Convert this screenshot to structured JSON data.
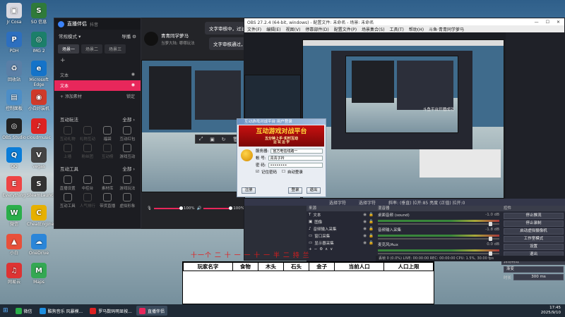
{
  "desktop_icons": [
    {
      "label": "Jr Cosa",
      "color": "#d8d8e0",
      "glyph": "▣"
    },
    {
      "label": "SO 信息",
      "color": "#2f7a3a",
      "glyph": "S"
    },
    {
      "label": "PDH",
      "color": "#2d6fbf",
      "glyph": "P"
    },
    {
      "label": "IMG 2",
      "color": "#1c7f6a",
      "glyph": "◎"
    },
    {
      "label": "回收站",
      "color": "#5b7fa6",
      "glyph": "♻"
    },
    {
      "label": "Microsoft Edge",
      "color": "#1473c9",
      "glyph": "e"
    },
    {
      "label": "控制面板",
      "color": "#4d8ec7",
      "glyph": "▤"
    },
    {
      "label": "小白好装机",
      "color": "#cf3a2a",
      "glyph": "◉"
    },
    {
      "label": "OBS Studio",
      "color": "#222",
      "glyph": "◎"
    },
    {
      "label": "cloudmusic",
      "color": "#d22",
      "glyph": "♪"
    },
    {
      "label": "QQ",
      "color": "#0b7dd8",
      "glyph": "Q"
    },
    {
      "label": "vegas",
      "color": "#444",
      "glyph": "V"
    },
    {
      "label": "Everything",
      "color": "#e44",
      "glyph": "E"
    },
    {
      "label": "SteamLaunchR",
      "color": "#333",
      "glyph": "S"
    },
    {
      "label": "微信",
      "color": "#2aae4a",
      "glyph": "W"
    },
    {
      "label": "CheatEngine",
      "color": "#e6b000",
      "glyph": "C"
    },
    {
      "label": "小白",
      "color": "#e8503a",
      "glyph": "▲"
    },
    {
      "label": "OneDrive",
      "color": "#2b86d9",
      "glyph": "☁"
    },
    {
      "label": "网易云",
      "color": "#d33",
      "glyph": "♫"
    },
    {
      "label": "Maps",
      "color": "#34a853",
      "glyph": "M"
    }
  ],
  "live": {
    "title": "直播伴侣",
    "subtitle": "抖音",
    "mode_label": "常规模式",
    "import_label": "导播",
    "scene_tabs": [
      "场景一",
      "场景二",
      "场景三"
    ],
    "add_symbol": "+",
    "sources": [
      {
        "label": "文本",
        "selected": false
      },
      {
        "label": "文本",
        "selected": true
      }
    ],
    "add_material": "+ 添加素材",
    "lock_label": "锁定",
    "streamer_name": "青青同学萝马",
    "streamer_sub": "当萝大陆: 哪哪玩法",
    "section_play": "互动玩法",
    "section_play_more": "全部 ›",
    "play_tools": [
      {
        "label": "互动礼物",
        "dim": true
      },
      {
        "label": "礼物互动",
        "dim": true
      },
      {
        "label": "福袋",
        "dim": false
      },
      {
        "label": "互动红包",
        "dim": false
      },
      {
        "label": "上墙",
        "dim": true
      },
      {
        "label": "粉丝团",
        "dim": true
      },
      {
        "label": "互动榜",
        "dim": true
      },
      {
        "label": "游戏互动",
        "dim": false
      }
    ],
    "section_tools": "互动工具",
    "section_tools_more": "全部 ›",
    "tools": [
      {
        "label": "直播设置",
        "dim": false
      },
      {
        "label": "中控台",
        "dim": false
      },
      {
        "label": "素材库",
        "dim": false
      },
      {
        "label": "游戏玩法",
        "dim": false
      },
      {
        "label": "互动工具",
        "dim": false
      },
      {
        "label": "人气排行",
        "dim": true
      },
      {
        "label": "带货直播",
        "dim": false
      },
      {
        "label": "虚拟形象",
        "dim": false
      }
    ],
    "volume_pct": "100%",
    "volume_pct2": "100%",
    "bubble1": "文字审核中，过滤",
    "bubble2": "文字审核通过，"
  },
  "obs": {
    "title": "OBS 27.2.4 (64-bit, windows) - 配置文件: 未命名 - 场景: 未命名",
    "menu": [
      "文件(F)",
      "编辑(E)",
      "视图(V)",
      "停靠部件(D)",
      "配置文件(P)",
      "场景集合(S)",
      "工具(T)",
      "帮助(H)",
      "斗鱼·青青同学萝马"
    ],
    "status_tabs": [
      "选择字符",
      "选择字符",
      "斜率: (垂直) 拉开:85 亮度 (正值) 拉开:0"
    ],
    "dock_sources_title": "来源",
    "sources": [
      {
        "label": "文本",
        "icon": "T"
      },
      {
        "label": "图像",
        "icon": "▣"
      },
      {
        "label": "音频输入采集",
        "icon": "♪"
      },
      {
        "label": "窗口采集",
        "icon": "▭"
      },
      {
        "label": "显示器采集",
        "icon": "▭"
      }
    ],
    "dock_mixer_title": "混音器",
    "mixer": [
      {
        "label": "桌面音频 (sound)",
        "db": "-1.0 dB"
      },
      {
        "label": "音频输入采集",
        "db": "-1.8 dB"
      },
      {
        "label": "麦克风/Aux",
        "db": "0.0 dB"
      }
    ],
    "dock_controls_title": "控件",
    "controls": [
      "停止推流",
      "停止录制",
      "启动虚拟摄像机",
      "工作室模式",
      "设置",
      "退出"
    ],
    "transition_title": "转场特效",
    "transition_value": "渐变",
    "duration_label": "时长",
    "duration_value": "300 ms",
    "status_bar": "丢帧 0 (0.0%)   LIVE: 00:00:00   REC: 00:00:00   CPU: 1.5%, 30.00 fps",
    "chat_label": "斗鱼平台开播成功",
    "chat_label2": "斗鱼平台开播成功"
  },
  "login": {
    "title": "互动游戏对战平台  用户登录",
    "banner_title": "互动游戏对战平台",
    "banner_line1": "五分钟上手·实时互动",
    "banner_line2": "边 玩 边 学",
    "server_label": "服务器:",
    "server_value": "官方电信线路一",
    "account_label": "帐 号:",
    "account_value": "青青子衿",
    "password_label": "密 码:",
    "password_value": "••••••••",
    "remember_label": "记住密码",
    "autologin_label": "自动登录",
    "btn_register": "注册",
    "btn_login": "登录",
    "btn_exit": "退出"
  },
  "red_overlay": "十一个 二 十 一 一 十 一 半 二 持 兰",
  "table": {
    "headers": [
      "玩家名字",
      "食物",
      "木头",
      "石头",
      "金子",
      "当前人口",
      "人口上限"
    ]
  },
  "taskbar": {
    "items": [
      {
        "label": "微信",
        "color": "#2aae4a",
        "active": false
      },
      {
        "label": "酷狗音乐 风暴模...",
        "color": "#1e8fe0",
        "active": false
      },
      {
        "label": "罗马数码明显按...",
        "color": "#d22",
        "active": false
      },
      {
        "label": "直播伴侣",
        "color": "#e8275b",
        "active": true
      }
    ],
    "time": "17:45",
    "date": "2025/9/10"
  }
}
